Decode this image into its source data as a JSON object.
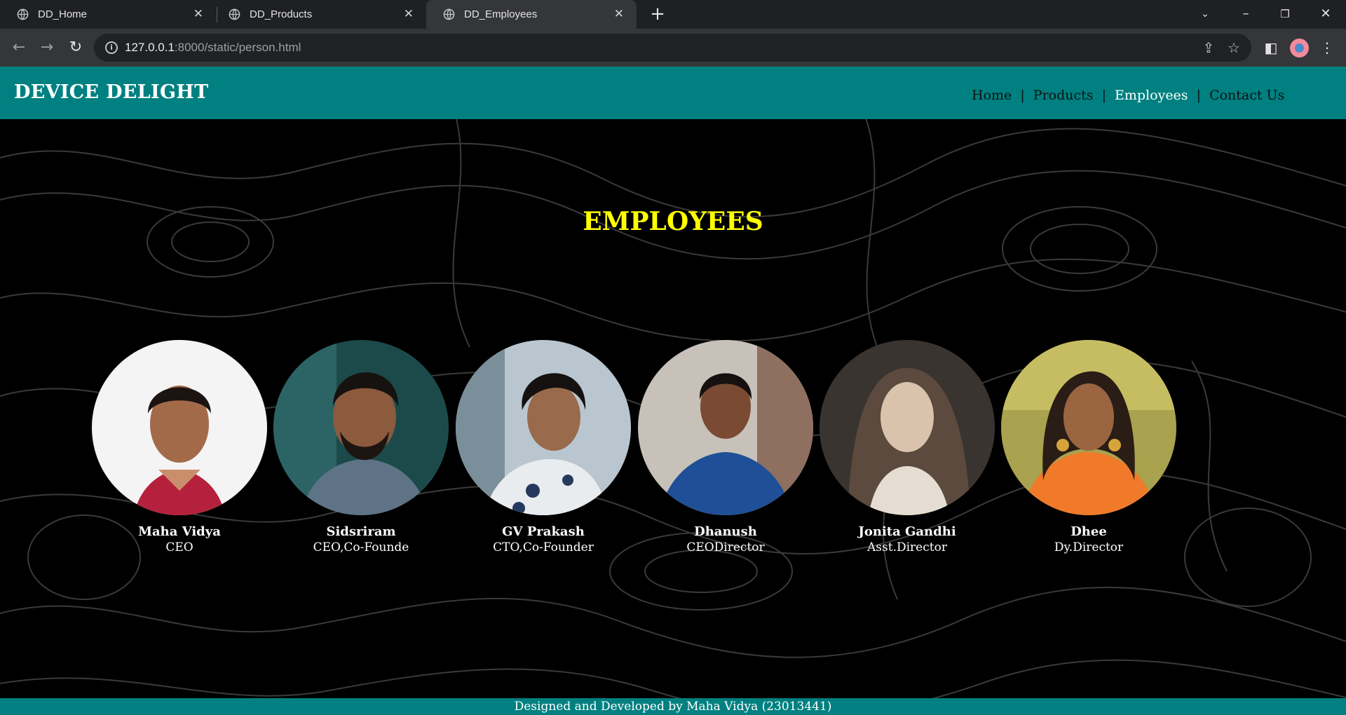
{
  "browser": {
    "tabs": [
      {
        "title": "DD_Home",
        "active": false
      },
      {
        "title": "DD_Products",
        "active": false
      },
      {
        "title": "DD_Employees",
        "active": true
      }
    ],
    "url_host": "127.0.0.1",
    "url_path": ":8000/static/person.html"
  },
  "site": {
    "brand": "DEVICE DELIGHT",
    "nav": [
      {
        "label": "Home",
        "current": false
      },
      {
        "label": "Products",
        "current": false
      },
      {
        "label": "Employees",
        "current": true
      },
      {
        "label": "Contact Us",
        "current": false
      }
    ],
    "nav_separator": "|",
    "heading": "EMPLOYEES",
    "employees": [
      {
        "name": "Maha Vidya",
        "role": "CEO"
      },
      {
        "name": "Sidsriram",
        "role": "CEO,Co-Founde"
      },
      {
        "name": "GV Prakash",
        "role": "CTO,Co-Founder"
      },
      {
        "name": "Dhanush",
        "role": "CEODirector"
      },
      {
        "name": "Jonita Gandhi",
        "role": "Asst.Director"
      },
      {
        "name": "Dhee",
        "role": "Dy.Director"
      }
    ],
    "footer": "Designed and Developed by Maha Vidya (23013441)"
  },
  "colors": {
    "header_bg": "#008080",
    "heading": "#ffff00",
    "page_bg": "#000000"
  }
}
